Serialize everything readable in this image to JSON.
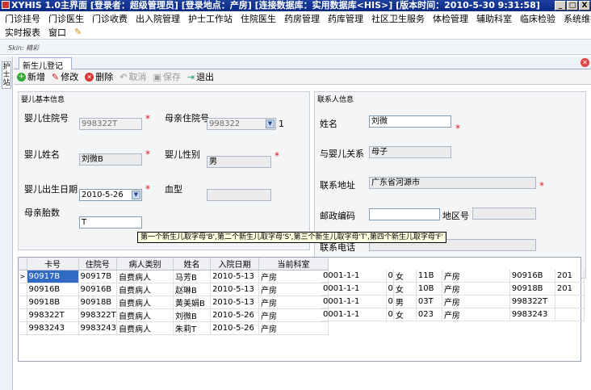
{
  "window": {
    "title": "XYHIS 1.0主界面  [登录者：超级管理员] [登录地点：产房] [连接数据库：实用数据库<HIS>] [版本时间：2010-5-30 9:31:58]",
    "buttons": [
      "_",
      "□",
      "X"
    ]
  },
  "menu": {
    "row1": [
      "门诊挂号",
      "门诊医生",
      "门诊收费",
      "出入院管理",
      "护士工作站",
      "住院医生",
      "药房管理",
      "药库管理",
      "社区卫生服务",
      "体检管理",
      "辅助科室",
      "临床检验",
      "系统维护"
    ],
    "row2": [
      "实时报表",
      "窗口"
    ]
  },
  "skin_label": "Skin: 精彩",
  "side_tab": "护士站",
  "tab": {
    "label": "新生儿登记"
  },
  "toolbar": {
    "add": "新增",
    "edit": "修改",
    "delete": "删除",
    "cancel": "取消",
    "save": "保存",
    "exit": "退出"
  },
  "baby_group": {
    "title": "婴儿基本信息",
    "inpatient_no_label": "婴儿住院号",
    "inpatient_no": "998322T",
    "mother_no_label": "母亲住院号",
    "mother_no": "998322",
    "mother_no_suffix": "1",
    "name_label": "婴儿姓名",
    "name": "刘微B",
    "sex_label": "婴儿性别",
    "sex": "男",
    "birth_label": "婴儿出生日期",
    "birth": "2010-5-26",
    "blood_label": "血型",
    "blood": "",
    "parity_label": "母亲胎数",
    "parity": "T"
  },
  "contact_group": {
    "title": "联系人信息",
    "name_label": "姓名",
    "name": "刘微",
    "relation_label": "与婴儿关系",
    "relation": "母子",
    "address_label": "联系地址",
    "address": "广东省河源市",
    "zip_label": "邮政编码",
    "zip": "",
    "area_label": "地区号",
    "area": "",
    "phone_label": "联系电话",
    "phone": ""
  },
  "tooltip": "第一个新生儿取字母'B',第二个新生儿取字母'S',第三个新生儿取字母'T',第四个新生儿取字母'F'",
  "grid": {
    "headers": [
      "卡号",
      "住院号",
      "病人类别",
      "姓名",
      "入院日期",
      "当前科室"
    ],
    "rows": [
      [
        "90917B",
        "90917B",
        "自费病人",
        "马芳B",
        "2010-5-13",
        "产房"
      ],
      [
        "90916B",
        "90916B",
        "自费病人",
        "赵琳B",
        "2010-5-13",
        "产房"
      ],
      [
        "90918B",
        "90918B",
        "自费病人",
        "黄美娟B",
        "2010-5-13",
        "产房"
      ],
      [
        "998322T",
        "998322T",
        "自费病人",
        "刘微B",
        "2010-5-26",
        "产房"
      ],
      [
        "9983243",
        "9983243",
        "自费病人",
        "朱莉T",
        "2010-5-26",
        "产房"
      ]
    ],
    "extra_rows": [
      [
        "",
        "",
        "",
        "",
        "",
        "",
        ""
      ],
      [
        "0001-1-1",
        "0",
        "女",
        "11B",
        "产房",
        "90916B",
        "201"
      ],
      [
        "0001-1-1",
        "0",
        "女",
        "10B",
        "产房",
        "90918B",
        "201"
      ],
      [
        "0001-1-1",
        "0",
        "男",
        "03T",
        "产房",
        "998322T",
        ""
      ],
      [
        "0001-1-1",
        "0",
        "女",
        "023",
        "产房",
        "9983243",
        ""
      ]
    ]
  }
}
